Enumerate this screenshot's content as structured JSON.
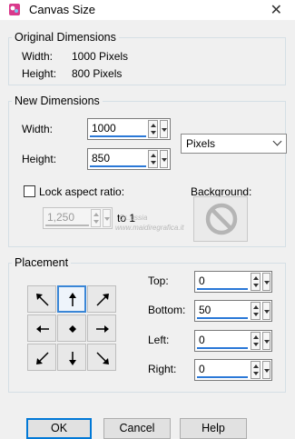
{
  "window": {
    "title": "Canvas Size"
  },
  "original": {
    "legend": "Original Dimensions",
    "width_label": "Width:",
    "width_value": "1000 Pixels",
    "height_label": "Height:",
    "height_value": "800 Pixels"
  },
  "new_dims": {
    "legend": "New Dimensions",
    "width_label": "Width:",
    "width_value": "1000",
    "height_label": "Height:",
    "height_value": "850",
    "units": "Pixels",
    "lock_label": "Lock aspect ratio:",
    "lock_checked": false,
    "ratio_value": "1,250",
    "ratio_suffix": "to 1",
    "background_label": "Background:"
  },
  "placement": {
    "legend": "Placement",
    "top_label": "Top:",
    "top_value": "0",
    "bottom_label": "Bottom:",
    "bottom_value": "50",
    "left_label": "Left:",
    "left_value": "0",
    "right_label": "Right:",
    "right_value": "0",
    "selected_anchor": "top-center"
  },
  "buttons": {
    "ok": "OK",
    "cancel": "Cancel",
    "help": "Help"
  },
  "watermark": {
    "line1": "Cr..ussia",
    "line2": "www.maidiregrafica.it"
  },
  "colors": {
    "accent": "#2a78d7",
    "focus": "#0078d7",
    "app_icon": "#d93a8c"
  }
}
